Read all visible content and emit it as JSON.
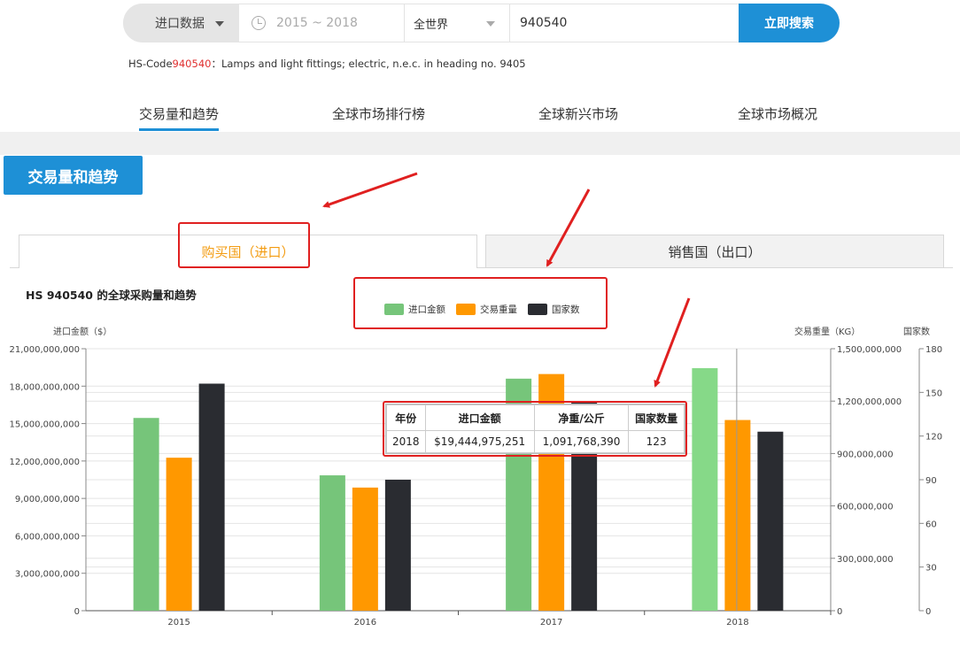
{
  "search": {
    "type_label": "进口数据",
    "date_range": "2015 ~ 2018",
    "region": "全世界",
    "code_value": "940540",
    "button_label": "立即搜索"
  },
  "hscode": {
    "prefix": "HS-Code",
    "code": "940540",
    "description": "：Lamps and light fittings; electric, n.e.c. in heading no. 9405"
  },
  "nav": {
    "items": [
      {
        "label": "交易量和趋势"
      },
      {
        "label": "全球市场排行榜"
      },
      {
        "label": "全球新兴市场"
      },
      {
        "label": "全球市场概况"
      }
    ],
    "active": 0
  },
  "section": {
    "title": "交易量和趋势"
  },
  "subtabs": [
    {
      "label": "购买国（进口）"
    },
    {
      "label": "销售国（出口）"
    }
  ],
  "chart_title": "HS 940540 的全球采购量和趋势",
  "colors": {
    "import_value": "#76c57a",
    "trade_weight": "#ff9800",
    "country_count": "#2a2c31",
    "accent": "#1e90d6",
    "highlight": "#e02020"
  },
  "chart_data": {
    "type": "bar",
    "categories": [
      "2015",
      "2016",
      "2017",
      "2018"
    ],
    "series": [
      {
        "name": "进口金额",
        "axis": "left",
        "values": [
          15450000000,
          10850000000,
          18600000000,
          19444975251
        ]
      },
      {
        "name": "交易重量",
        "axis": "right1",
        "values": [
          876000000,
          705000000,
          1355000000,
          1091768390
        ]
      },
      {
        "name": "国家数",
        "axis": "right2",
        "values": [
          156,
          90,
          143,
          123
        ]
      }
    ],
    "axes": {
      "left": {
        "label": "进口金额（$）",
        "ylim": [
          0,
          21000000000
        ],
        "ticks": [
          "0",
          "3,000,000,000",
          "6,000,000,000",
          "9,000,000,000",
          "12,000,000,000",
          "15,000,000,000",
          "18,000,000,000",
          "21,000,000,000"
        ]
      },
      "right1": {
        "label": "交易重量（KG）",
        "ylim": [
          0,
          1500000000
        ],
        "ticks": [
          "0",
          "300,000,000",
          "600,000,000",
          "900,000,000",
          "1,200,000,000",
          "1,500,000,000"
        ]
      },
      "right2": {
        "label": "国家数",
        "ylim": [
          0,
          180
        ],
        "ticks": [
          "0",
          "30",
          "60",
          "90",
          "120",
          "150",
          "180"
        ]
      }
    },
    "grid": true,
    "legend_placement": "top-center"
  },
  "tooltip": {
    "headers": [
      "年份",
      "进口金额",
      "净重/公斤",
      "国家数量"
    ],
    "row": [
      "2018",
      "$19,444,975,251",
      "1,091,768,390",
      "123"
    ]
  }
}
